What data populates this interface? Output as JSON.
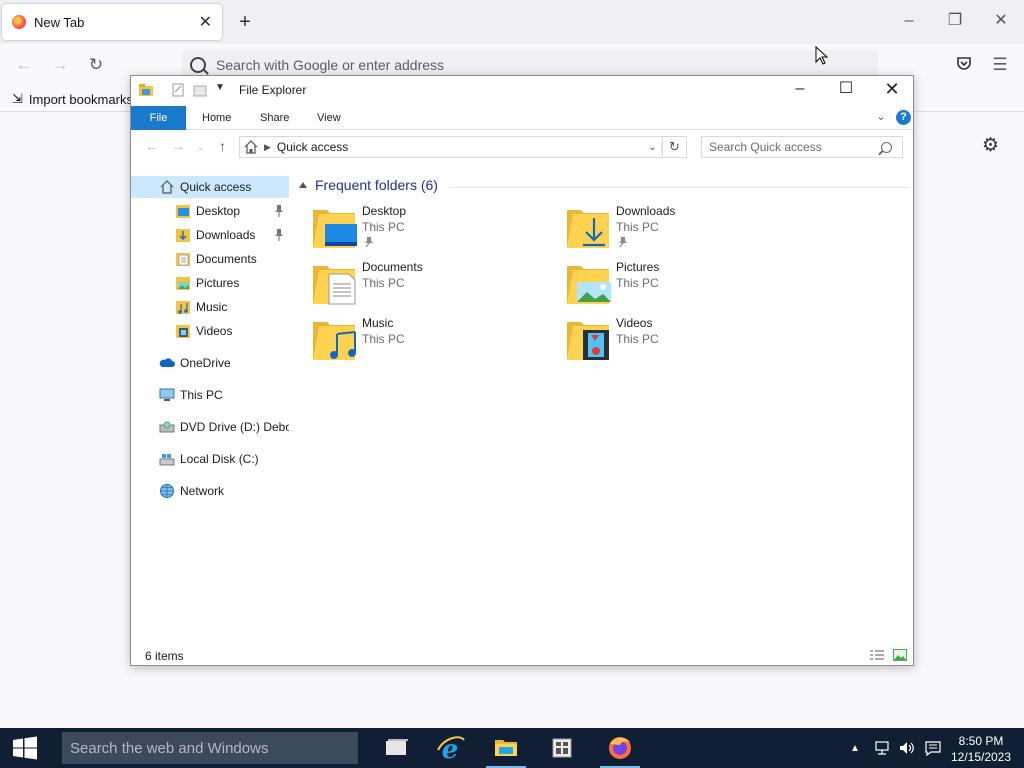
{
  "firefox": {
    "tab_title": "New Tab",
    "tab_close": "✕",
    "new_tab": "+",
    "url_placeholder": "Search with Google or enter address",
    "import_bookmarks": "Import bookmarks"
  },
  "explorer": {
    "title": "File Explorer",
    "ribbon_tabs": [
      "File",
      "Home",
      "Share",
      "View"
    ],
    "help": "?",
    "address": "Quick access",
    "search_placeholder": "Search Quick access",
    "nav": [
      {
        "label": "Quick access",
        "icon": "star-icon"
      },
      {
        "label": "Desktop",
        "icon": "desktop-folder-icon"
      },
      {
        "label": "Downloads",
        "icon": "downloads-folder-icon"
      },
      {
        "label": "Documents",
        "icon": "documents-folder-icon"
      },
      {
        "label": "Pictures",
        "icon": "pictures-folder-icon"
      },
      {
        "label": "Music",
        "icon": "music-folder-icon"
      },
      {
        "label": "Videos",
        "icon": "videos-folder-icon"
      },
      {
        "label": "OneDrive",
        "icon": "onedrive-icon"
      },
      {
        "label": "This PC",
        "icon": "computer-icon"
      },
      {
        "label": "DVD Drive (D:) Debor",
        "icon": "dvd-drive-icon"
      },
      {
        "label": "Local Disk (C:)",
        "icon": "local-disk-icon"
      },
      {
        "label": "Network",
        "icon": "network-icon"
      }
    ],
    "group_header": "Frequent folders (6)",
    "folders": [
      {
        "name": "Desktop",
        "location": "This PC",
        "pinned": true
      },
      {
        "name": "Downloads",
        "location": "This PC",
        "pinned": true
      },
      {
        "name": "Documents",
        "location": "This PC",
        "pinned": false
      },
      {
        "name": "Pictures",
        "location": "This PC",
        "pinned": false
      },
      {
        "name": "Music",
        "location": "This PC",
        "pinned": false
      },
      {
        "name": "Videos",
        "location": "This PC",
        "pinned": false
      }
    ],
    "status": "6 items"
  },
  "taskbar": {
    "search_placeholder": "Search the web and Windows",
    "time": "8:50 PM",
    "date": "12/15/2023"
  },
  "colors": {
    "accent": "#1979ca",
    "folder_yellow": "#ffd34e",
    "taskbar": "#101f33"
  }
}
